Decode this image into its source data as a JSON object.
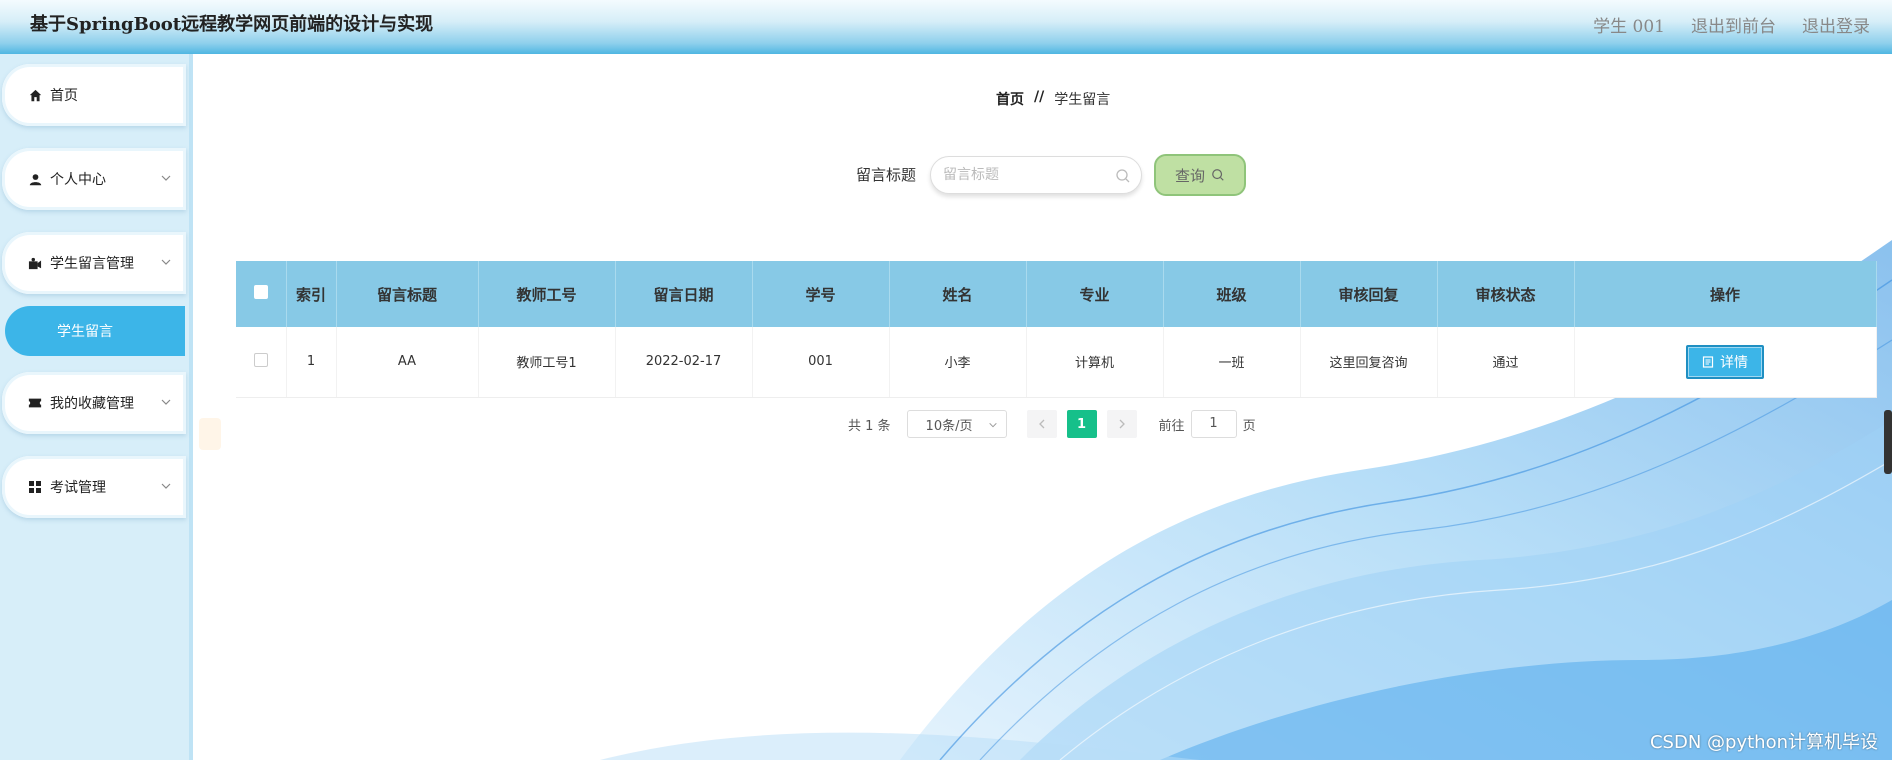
{
  "header": {
    "title": "基于SpringBoot远程教学网页前端的设计与实现",
    "user": "学生 001",
    "back_front": "退出到前台",
    "logout": "退出登录"
  },
  "sidebar": {
    "items": [
      {
        "label": "首页",
        "icon": "home-icon"
      },
      {
        "label": "个人中心",
        "icon": "user-icon"
      },
      {
        "label": "学生留言管理",
        "icon": "message-icon"
      },
      {
        "label": "学生留言",
        "icon": ""
      },
      {
        "label": "我的收藏管理",
        "icon": "ticket-icon"
      },
      {
        "label": "考试管理",
        "icon": "grid-icon"
      }
    ]
  },
  "breadcrumb": {
    "home": "首页",
    "sep": "//",
    "current": "学生留言"
  },
  "search": {
    "label": "留言标题",
    "placeholder": "留言标题",
    "button": "查询"
  },
  "table": {
    "columns": [
      "索引",
      "留言标题",
      "教师工号",
      "留言日期",
      "学号",
      "姓名",
      "专业",
      "班级",
      "审核回复",
      "审核状态",
      "操作"
    ],
    "rows": [
      {
        "index": "1",
        "title": "AA",
        "teacher_id": "教师工号1",
        "date": "2022-02-17",
        "student_id": "001",
        "name": "小李",
        "major": "计算机",
        "class": "一班",
        "reply": "这里回复咨询",
        "status": "通过",
        "action": "详情"
      }
    ]
  },
  "pager": {
    "total": "共 1 条",
    "page_size": "10条/页",
    "current_page": "1",
    "goto_label": "前往",
    "goto_value": "1",
    "page_suffix": "页"
  },
  "watermark": "CSDN @python计算机毕设",
  "colors": {
    "accent": "#3cb5e8",
    "header_row": "#87c9e6",
    "active_page": "#16c08a",
    "search_button": "#bfe0a3"
  }
}
